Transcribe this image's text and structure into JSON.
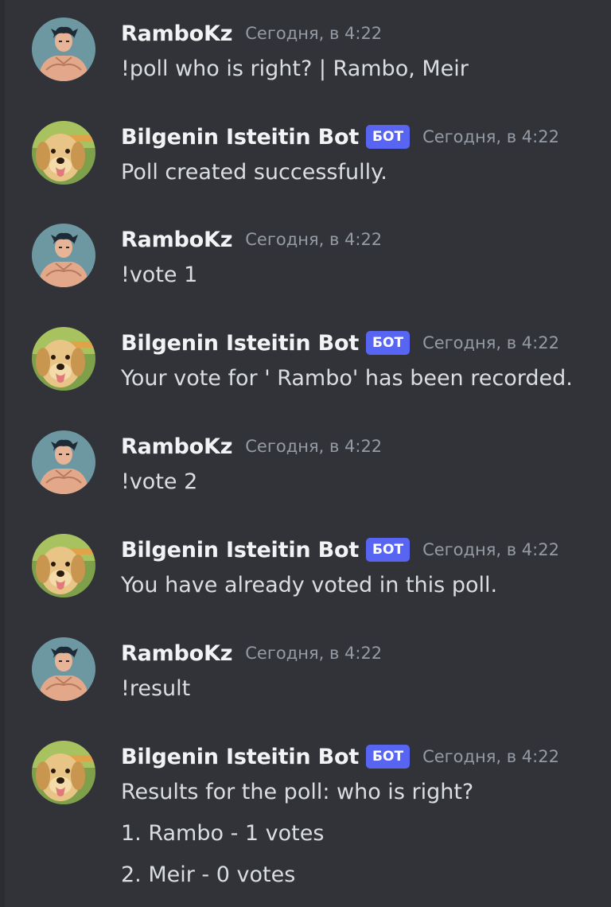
{
  "colors": {
    "background": "#313338",
    "username": "#f2f3f5",
    "message_text": "#dbdee1",
    "timestamp": "#949ba4",
    "bot_tag_bg": "#5865f2"
  },
  "messages": [
    {
      "author": "RamboKz",
      "avatar_icon": "anime-muscular-man-avatar",
      "timestamp": "Сегодня, в 4:22",
      "lines": [
        "!poll who is right? | Rambo, Meir"
      ]
    },
    {
      "author": "Bilgenin Isteitin Bot",
      "bot_tag": "БОТ",
      "avatar_icon": "golden-retriever-dog-avatar",
      "timestamp": "Сегодня, в 4:22",
      "lines": [
        "Poll created successfully."
      ]
    },
    {
      "author": "RamboKz",
      "avatar_icon": "anime-muscular-man-avatar",
      "timestamp": "Сегодня, в 4:22",
      "lines": [
        "!vote 1"
      ]
    },
    {
      "author": "Bilgenin Isteitin Bot",
      "bot_tag": "БОТ",
      "avatar_icon": "golden-retriever-dog-avatar",
      "timestamp": "Сегодня, в 4:22",
      "lines": [
        "Your vote for ' Rambo' has been recorded."
      ]
    },
    {
      "author": "RamboKz",
      "avatar_icon": "anime-muscular-man-avatar",
      "timestamp": "Сегодня, в 4:22",
      "lines": [
        "!vote 2"
      ]
    },
    {
      "author": "Bilgenin Isteitin Bot",
      "bot_tag": "БОТ",
      "avatar_icon": "golden-retriever-dog-avatar",
      "timestamp": "Сегодня, в 4:22",
      "lines": [
        "You have already voted in this poll."
      ]
    },
    {
      "author": "RamboKz",
      "avatar_icon": "anime-muscular-man-avatar",
      "timestamp": "Сегодня, в 4:22",
      "lines": [
        "!result"
      ]
    },
    {
      "author": "Bilgenin Isteitin Bot",
      "bot_tag": "БОТ",
      "avatar_icon": "golden-retriever-dog-avatar",
      "timestamp": "Сегодня, в 4:22",
      "lines": [
        "Results for the poll: who is right?",
        "1. Rambo - 1 votes",
        "2. Meir - 0 votes"
      ]
    }
  ]
}
